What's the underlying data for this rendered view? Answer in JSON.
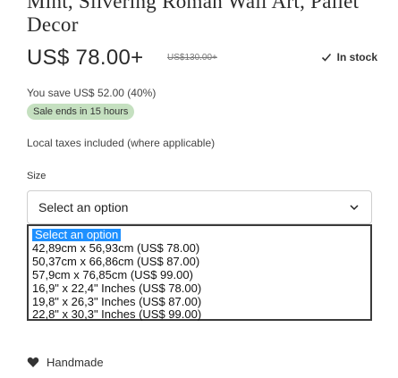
{
  "product": {
    "title": "Mint, Silvering Roman Wall Art, Pallet Decor",
    "price": "US$ 78.00+",
    "compare_price": "US$130.00+",
    "stock_status": "In stock",
    "savings": "You save US$ 52.00 (40%)",
    "sale_badge": "Sale ends in 15 hours",
    "tax_note": "Local taxes included (where applicable)"
  },
  "size_select": {
    "label": "Size",
    "value": "Select an option",
    "options": [
      "Select an option",
      "42,89cm x 56,93cm (US$ 78.00)",
      "50,37cm x 66,86cm (US$ 87.00)",
      "57,9cm x 76,85cm (US$ 99.00)",
      "16,9\" x 22,4\" Inches (US$ 78.00)",
      "19,8\" x 26,3\" Inches (US$ 87.00)",
      "22,8\" x 30,3\" Inches (US$ 99.00)"
    ],
    "highlighted_index": 0
  },
  "feature": {
    "icon": "heart-icon",
    "label": "Handmade"
  },
  "colors": {
    "sale_badge_bg": "#c5e0c0",
    "option_highlight": "#1e90ff",
    "listbox_border": "#3b3b3b"
  }
}
